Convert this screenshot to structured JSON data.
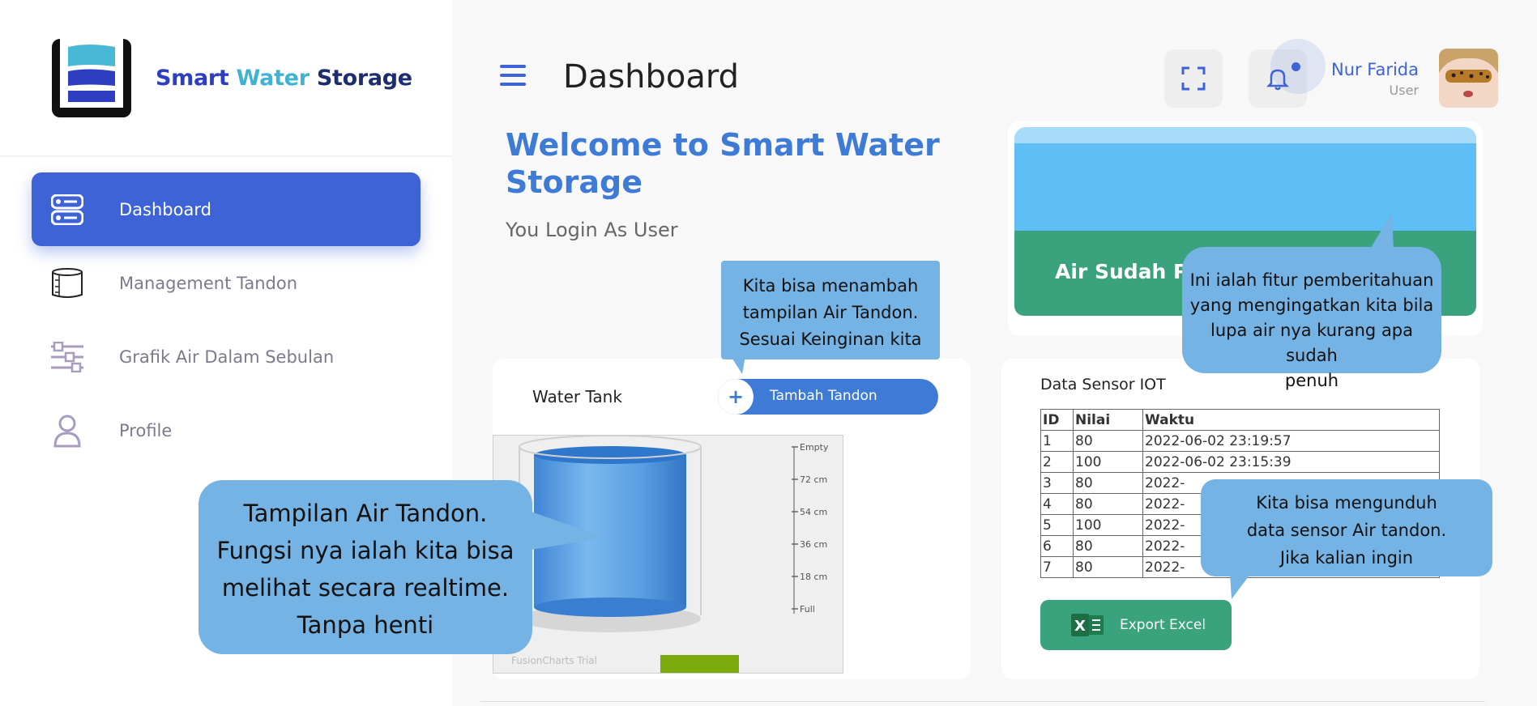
{
  "brand": {
    "name_part1": "Smart",
    "name_part2": "Water",
    "name_part3": "Storage"
  },
  "sidebar": {
    "items": [
      {
        "label": "Dashboard",
        "icon": "server-icon",
        "active": true
      },
      {
        "label": "Management Tandon",
        "icon": "cylinder-icon",
        "active": false
      },
      {
        "label": "Grafik Air Dalam Sebulan",
        "icon": "sliders-icon",
        "active": false
      },
      {
        "label": "Profile",
        "icon": "user-icon",
        "active": false
      }
    ]
  },
  "header": {
    "title": "Dashboard",
    "user_name": "Nur Farida",
    "user_role": "User"
  },
  "welcome": {
    "title": "Welcome to Smart Water Storage",
    "subtitle": "You Login As User"
  },
  "notification": {
    "text": "Air Sudah Pe"
  },
  "tank": {
    "title": "Water Tank",
    "add_button": "Tambah Tandon",
    "add_plus": "+",
    "trial_label": "FusionCharts Trial"
  },
  "chart_data": {
    "type": "cylinder-gauge",
    "ticks": [
      "Empty",
      "72 cm",
      "54 cm",
      "36 cm",
      "18 cm",
      "Full"
    ],
    "fill_fraction": 1.0
  },
  "sensor": {
    "title": "Data Sensor IOT",
    "columns": [
      "ID",
      "Nilai",
      "Waktu"
    ],
    "rows": [
      [
        "1",
        "80",
        "2022-06-02 23:19:57"
      ],
      [
        "2",
        "100",
        "2022-06-02 23:15:39"
      ],
      [
        "3",
        "80",
        "2022-"
      ],
      [
        "4",
        "80",
        "2022-"
      ],
      [
        "5",
        "100",
        "2022-"
      ],
      [
        "6",
        "80",
        "2022-"
      ],
      [
        "7",
        "80",
        "2022-"
      ]
    ],
    "export_button": "Export Excel"
  },
  "callouts": {
    "tambah": [
      "Kita bisa menambah",
      "tampilan Air Tandon.",
      "Sesuai Keinginan kita"
    ],
    "notif": [
      "Ini ialah fitur pemberitahuan",
      "yang mengingatkan kita bila",
      "lupa air nya kurang apa sudah",
      "penuh"
    ],
    "sensor": [
      "Kita bisa mengunduh",
      "data sensor Air tandon.",
      "Jika kalian ingin"
    ],
    "tampilan": [
      "Tampilan Air Tandon.",
      "Fungsi nya ialah kita bisa",
      "melihat secara realtime.",
      "Tanpa henti"
    ]
  },
  "colors": {
    "accent": "#3d63d6",
    "title_blue": "#3d7bd6",
    "green": "#3aa27d",
    "callout": "#74b3e3"
  }
}
